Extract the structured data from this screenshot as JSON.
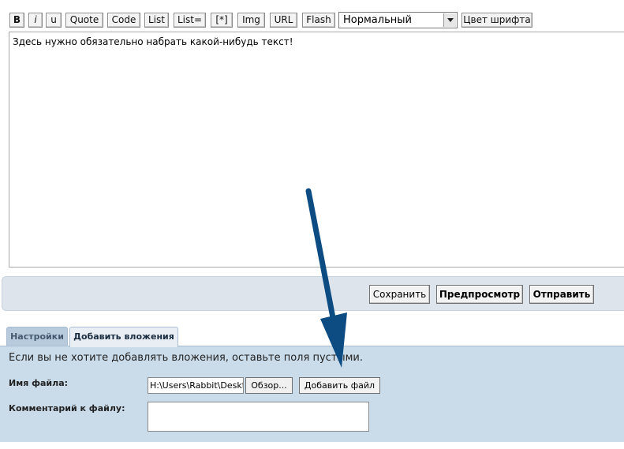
{
  "toolbar": {
    "buttons": [
      "B",
      "i",
      "u",
      "Quote",
      "Code",
      "List",
      "List=",
      "[*]",
      "Img",
      "URL",
      "Flash"
    ],
    "size_select": "Нормальный",
    "font_color": "Цвет шрифта"
  },
  "editor": {
    "text": "Здесь нужно обязательно набрать какой-нибудь текст!"
  },
  "actions": {
    "save": "Сохранить",
    "preview": "Предпросмотр",
    "submit": "Отправить"
  },
  "tabs": [
    {
      "label": "Настройки",
      "active": false
    },
    {
      "label": "Добавить вложения",
      "active": true
    }
  ],
  "attachments": {
    "notice": "Если вы не хотите добавлять вложения, оставьте поля пустыми.",
    "file_label": "Имя файла:",
    "file_value": "H:\\Users\\Rabbit\\Deskto",
    "browse": "Обзор...",
    "add_file": "Добавить файл",
    "comment_label": "Комментарий к файлу:",
    "comment_value": ""
  },
  "colors": {
    "panel": "#cadcea",
    "arrow": "#0d4c82"
  }
}
